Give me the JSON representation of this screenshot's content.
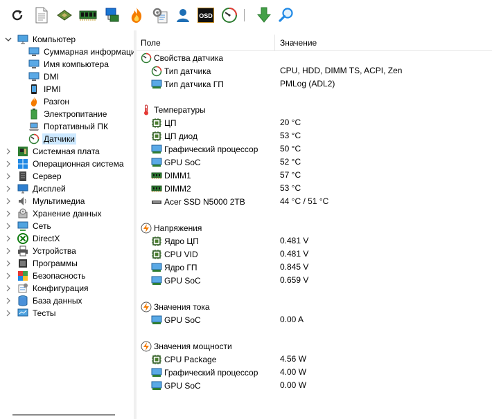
{
  "toolbar": {
    "buttons": [
      {
        "icon": "refresh-icon"
      },
      {
        "icon": "report-icon"
      },
      {
        "icon": "cpu-chip-icon"
      },
      {
        "icon": "memory-module-icon"
      },
      {
        "icon": "network-icon"
      },
      {
        "icon": "overclock-flame-icon"
      },
      {
        "icon": "settings-tools-icon"
      },
      {
        "icon": "user-icon"
      },
      {
        "icon": "osd-icon",
        "label": "OSD"
      },
      {
        "icon": "gauge-icon"
      },
      {
        "icon": "download-arrow-icon"
      },
      {
        "icon": "search-icon"
      }
    ]
  },
  "tree": {
    "root_label": "Компьютер",
    "children": [
      {
        "label": "Суммарная информация"
      },
      {
        "label": "Имя компьютера"
      },
      {
        "label": "DMI"
      },
      {
        "label": "IPMI"
      },
      {
        "label": "Разгон"
      },
      {
        "label": "Электропитание"
      },
      {
        "label": "Портативный ПК"
      },
      {
        "label": "Датчики",
        "selected": true
      }
    ],
    "top_items": [
      {
        "label": "Системная плата"
      },
      {
        "label": "Операционная система"
      },
      {
        "label": "Сервер"
      },
      {
        "label": "Дисплей"
      },
      {
        "label": "Мультимедиа"
      },
      {
        "label": "Хранение данных"
      },
      {
        "label": "Сеть"
      },
      {
        "label": "DirectX"
      },
      {
        "label": "Устройства"
      },
      {
        "label": "Программы"
      },
      {
        "label": "Безопасность"
      },
      {
        "label": "Конфигурация"
      },
      {
        "label": "База данных"
      },
      {
        "label": "Тесты"
      }
    ]
  },
  "list": {
    "col_field": "Поле",
    "col_value": "Значение",
    "groups": [
      {
        "title": "Свойства датчика",
        "items": [
          {
            "name": "Тип датчика",
            "value": "CPU, HDD, DIMM TS, ACPI, Zen"
          },
          {
            "name": "Тип датчика ГП",
            "value": "PMLog  (ADL2)"
          }
        ]
      },
      {
        "title": "Температуры",
        "items": [
          {
            "name": "ЦП",
            "value": "20 °C"
          },
          {
            "name": "ЦП диод",
            "value": "53 °C"
          },
          {
            "name": "Графический процессор",
            "value": "50 °C"
          },
          {
            "name": "GPU SoC",
            "value": "52 °C"
          },
          {
            "name": "DIMM1",
            "value": "57 °C"
          },
          {
            "name": "DIMM2",
            "value": "53 °C"
          },
          {
            "name": "Acer SSD N5000 2TB",
            "value": "44 °C / 51 °C"
          }
        ]
      },
      {
        "title": "Напряжения",
        "items": [
          {
            "name": "Ядро ЦП",
            "value": "0.481 V"
          },
          {
            "name": "CPU VID",
            "value": "0.481 V"
          },
          {
            "name": "Ядро ГП",
            "value": "0.845 V"
          },
          {
            "name": "GPU SoC",
            "value": "0.659 V"
          }
        ]
      },
      {
        "title": "Значения тока",
        "items": [
          {
            "name": "GPU SoC",
            "value": "0.00 A"
          }
        ]
      },
      {
        "title": "Значения мощности",
        "items": [
          {
            "name": "CPU Package",
            "value": "4.56 W"
          },
          {
            "name": "Графический процессор",
            "value": "4.00 W"
          },
          {
            "name": "GPU SoC",
            "value": "0.00 W"
          }
        ]
      }
    ]
  }
}
